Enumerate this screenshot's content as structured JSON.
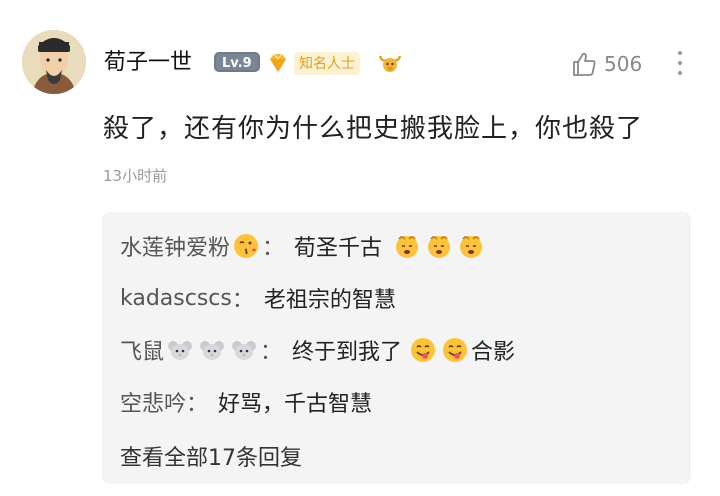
{
  "user": {
    "name": "荀子一世",
    "level": "Lv.9",
    "fame_label": "知名人士",
    "avatar_icon": "scholar-portrait-avatar",
    "medal_icon": "bull-medal-icon"
  },
  "like": {
    "count": "506",
    "icon": "thumbs-up-icon"
  },
  "comment": {
    "text": "殺了，还有你为什么把史搬我脸上，你也殺了",
    "time": "13小时前"
  },
  "replies": [
    {
      "name": "水莲钟爱粉",
      "sep": "：",
      "text": "荀圣千古"
    },
    {
      "name": "kadascscs",
      "sep": "：",
      "text": "老祖宗的智慧"
    },
    {
      "name": "飞鼠",
      "sep": "：",
      "text": "终于到我了",
      "suffix": "合影"
    },
    {
      "name": "空悲吟",
      "sep": "：",
      "text": "好骂，千古智慧"
    }
  ],
  "more_replies": "查看全部17条回复",
  "colors": {
    "reply_bg": "#f4f4f4",
    "time": "#999999",
    "fame": "#e0a21d"
  }
}
